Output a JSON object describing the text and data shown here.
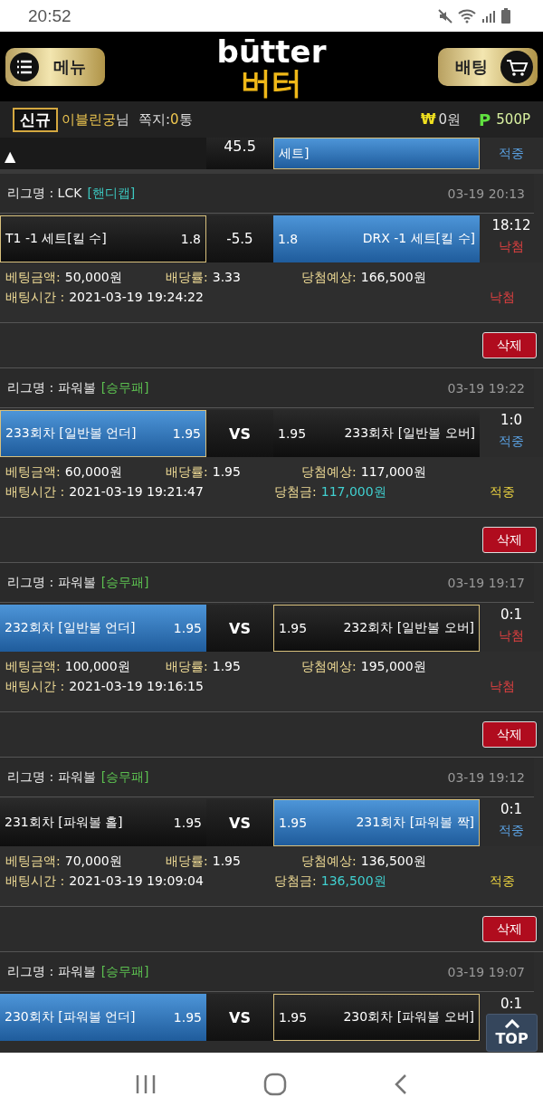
{
  "status_bar": {
    "time": "20:52"
  },
  "header": {
    "menu_label": "메뉴",
    "logo_top": "būtter",
    "logo_bottom": "버터",
    "bet_label": "배팅"
  },
  "user_bar": {
    "badge": "신규",
    "name": "이블린궁",
    "name_suffix": "님",
    "memo_label": "쪽지:",
    "memo_count": "0",
    "memo_unit": "통",
    "cash_icon": "₩",
    "cash": "0원",
    "point_icon": "P",
    "points": "500P"
  },
  "partial_bet": {
    "marker": "▲",
    "handicap": "45.5",
    "right_pick": "세트]",
    "result": {
      "kind": "win",
      "label": "적중"
    }
  },
  "bets": [
    {
      "league": "리그명 : LCK",
      "market": {
        "kind": "handicap",
        "label": "[핸디캡]"
      },
      "time": "03-19 20:13",
      "home": {
        "name": "T1 -1 세트[킬 수]",
        "odds": "1.8",
        "selected": false,
        "outlined": true
      },
      "middle": {
        "kind": "line",
        "label": "-5.5"
      },
      "away": {
        "name": "DRX -1 세트[킬 수]",
        "odds": "1.8",
        "selected": true,
        "outlined": false
      },
      "score": "18:12",
      "result": {
        "kind": "lose",
        "label": "낙첨"
      },
      "info": {
        "amount_label": "베팅금액:",
        "amount": "50,000원",
        "odds_label": "배당률:",
        "odds": "3.33",
        "expected_label": "당첨예상:",
        "expected": "166,500원",
        "time_label": "배팅시간 :",
        "bet_time": "2021-03-19 19:24:22",
        "status": {
          "kind": "lose",
          "label": "낙첨"
        }
      },
      "delete_label": "삭제"
    },
    {
      "league": "리그명 : 파워볼",
      "market": {
        "kind": "wdl",
        "label": "[승무패]"
      },
      "time": "03-19 19:22",
      "home": {
        "name": "233회차 [일반볼 언더]",
        "odds": "1.95",
        "selected": true,
        "outlined": true
      },
      "middle": {
        "kind": "vs",
        "label": "VS"
      },
      "away": {
        "name": "233회차 [일반볼 오버]",
        "odds": "1.95",
        "selected": false,
        "outlined": false
      },
      "score": "1:0",
      "result": {
        "kind": "win",
        "label": "적중"
      },
      "info": {
        "amount_label": "베팅금액:",
        "amount": "60,000원",
        "odds_label": "배당률:",
        "odds": "1.95",
        "expected_label": "당첨예상:",
        "expected": "117,000원",
        "time_label": "배팅시간 :",
        "bet_time": "2021-03-19 19:21:47",
        "payout_label": "당첨금:",
        "payout": "117,000원",
        "status": {
          "kind": "win",
          "label": "적중"
        }
      },
      "delete_label": "삭제"
    },
    {
      "league": "리그명 : 파워볼",
      "market": {
        "kind": "wdl",
        "label": "[승무패]"
      },
      "time": "03-19 19:17",
      "home": {
        "name": "232회차 [일반볼 언더]",
        "odds": "1.95",
        "selected": true,
        "outlined": false
      },
      "middle": {
        "kind": "vs",
        "label": "VS"
      },
      "away": {
        "name": "232회차 [일반볼 오버]",
        "odds": "1.95",
        "selected": false,
        "outlined": true
      },
      "score": "0:1",
      "result": {
        "kind": "lose",
        "label": "낙첨"
      },
      "info": {
        "amount_label": "베팅금액:",
        "amount": "100,000원",
        "odds_label": "배당률:",
        "odds": "1.95",
        "expected_label": "당첨예상:",
        "expected": "195,000원",
        "time_label": "배팅시간 :",
        "bet_time": "2021-03-19 19:16:15",
        "status": {
          "kind": "lose",
          "label": "낙첨"
        }
      },
      "delete_label": "삭제"
    },
    {
      "league": "리그명 : 파워볼",
      "market": {
        "kind": "wdl",
        "label": "[승무패]"
      },
      "time": "03-19 19:12",
      "home": {
        "name": "231회차 [파워볼 홀]",
        "odds": "1.95",
        "selected": false,
        "outlined": false
      },
      "middle": {
        "kind": "vs",
        "label": "VS"
      },
      "away": {
        "name": "231회차 [파워볼 짝]",
        "odds": "1.95",
        "selected": true,
        "outlined": true
      },
      "score": "0:1",
      "result": {
        "kind": "win",
        "label": "적중"
      },
      "info": {
        "amount_label": "베팅금액:",
        "amount": "70,000원",
        "odds_label": "배당률:",
        "odds": "1.95",
        "expected_label": "당첨예상:",
        "expected": "136,500원",
        "time_label": "배팅시간 :",
        "bet_time": "2021-03-19 19:09:04",
        "payout_label": "당첨금:",
        "payout": "136,500원",
        "status": {
          "kind": "win",
          "label": "적중"
        }
      },
      "delete_label": "삭제"
    },
    {
      "league": "리그명 : 파워볼",
      "market": {
        "kind": "wdl",
        "label": "[승무패]"
      },
      "time": "03-19 19:07",
      "home": {
        "name": "230회차 [파워볼 언더]",
        "odds": "1.95",
        "selected": true,
        "outlined": false
      },
      "middle": {
        "kind": "vs",
        "label": "VS"
      },
      "away": {
        "name": "230회차 [파워볼 오버]",
        "odds": "1.95",
        "selected": false,
        "outlined": true
      },
      "score": "0:1"
    }
  ],
  "top_button": {
    "label": "TOP"
  }
}
